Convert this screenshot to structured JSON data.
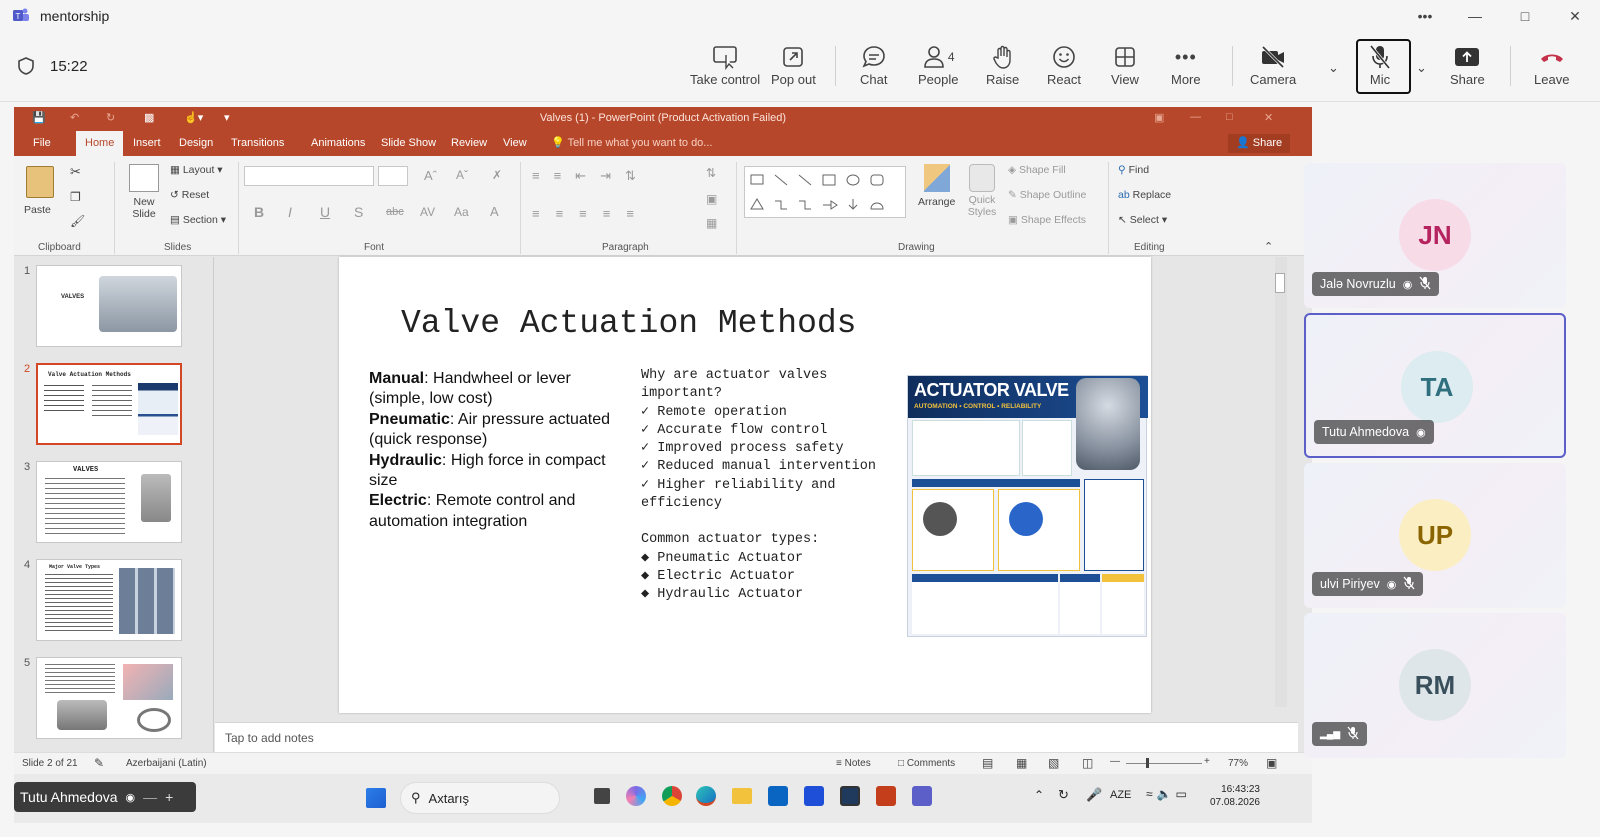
{
  "window": {
    "title": "mentorship"
  },
  "meeting": {
    "timer": "15:22",
    "people_count": "4"
  },
  "toolbar": [
    {
      "key": "take_control",
      "label": "Take control"
    },
    {
      "key": "pop_out",
      "label": "Pop out"
    },
    {
      "key": "chat",
      "label": "Chat"
    },
    {
      "key": "people",
      "label": "People"
    },
    {
      "key": "raise",
      "label": "Raise"
    },
    {
      "key": "react",
      "label": "React"
    },
    {
      "key": "view",
      "label": "View"
    },
    {
      "key": "more",
      "label": "More"
    },
    {
      "key": "camera",
      "label": "Camera"
    },
    {
      "key": "mic",
      "label": "Mic"
    },
    {
      "key": "share",
      "label": "Share"
    },
    {
      "key": "leave",
      "label": "Leave"
    }
  ],
  "ppt": {
    "title": "Valves (1) - PowerPoint (Product Activation Failed)",
    "tabs": [
      "File",
      "Home",
      "Insert",
      "Design",
      "Transitions",
      "Animations",
      "Slide Show",
      "Review",
      "View"
    ],
    "tell_me": "Tell me what you want to do...",
    "share": "Share",
    "ribbon": {
      "clipboard": "Clipboard",
      "paste": "Paste",
      "slides": "Slides",
      "new_slide": "New Slide",
      "layout": "Layout",
      "reset": "Reset",
      "section": "Section",
      "font": "Font",
      "paragraph": "Paragraph",
      "drawing": "Drawing",
      "arrange": "Arrange",
      "quick_styles": "Quick Styles",
      "shape_fill": "Shape Fill",
      "shape_outline": "Shape Outline",
      "shape_effects": "Shape Effects",
      "editing": "Editing",
      "find": "Find",
      "replace": "Replace",
      "select": "Select"
    },
    "thumb_numbers": [
      "1",
      "2",
      "3",
      "4",
      "5"
    ],
    "thumb_titles": {
      "t3": "VALVES",
      "t4": "Major Valve Types",
      "t2": "Valve Actuation Methods"
    },
    "slide": {
      "title": "Valve Actuation Methods",
      "methods": [
        {
          "name": "Manual",
          "desc": ": Handwheel or lever (simple, low cost)"
        },
        {
          "name": "Pneumatic",
          "desc": ": Air pressure actuated (quick response)"
        },
        {
          "name": "Hydraulic",
          "desc": ": High force in compact size"
        },
        {
          "name": "Electric",
          "desc": ": Remote control and automation integration"
        }
      ],
      "why_heading": "Why are actuator valves important?",
      "why_items": [
        "Remote operation",
        "Accurate flow control",
        "Improved process safety",
        "Reduced manual intervention",
        "Higher reliability and efficiency"
      ],
      "types_heading": "Common actuator types:",
      "types": [
        "Pneumatic Actuator",
        "Electric Actuator",
        "Hydraulic Actuator"
      ],
      "poster": {
        "title": "ACTUATOR VALVE",
        "subtitle": "AUTOMATION • CONTROL • RELIABILITY"
      }
    },
    "notes_placeholder": "Tap to add notes",
    "status": {
      "slide": "Slide 2 of 21",
      "language": "Azerbaijani (Latin)",
      "notes": "Notes",
      "comments": "Comments",
      "zoom": "77%"
    }
  },
  "taskbar": {
    "sharer": "Tutu Ahmedova",
    "search": "Axtarış",
    "lang": "AZE",
    "time": "16:43:23",
    "date": "07.08.2026"
  },
  "participants": [
    {
      "initials": "JN",
      "name": "Jalə Novruzlu",
      "avatar_bg": "#f7dbe7",
      "avatar_fg": "#b5245f"
    },
    {
      "initials": "TA",
      "name": "Tutu Ahmedova",
      "avatar_bg": "#dcecf0",
      "avatar_fg": "#2f6f7e"
    },
    {
      "initials": "UP",
      "name": "ulvi Piriyev",
      "avatar_bg": "#fbeec2",
      "avatar_fg": "#8a6400"
    },
    {
      "initials": "RM",
      "name": "",
      "avatar_bg": "#dfe6ea",
      "avatar_fg": "#39505c"
    }
  ]
}
